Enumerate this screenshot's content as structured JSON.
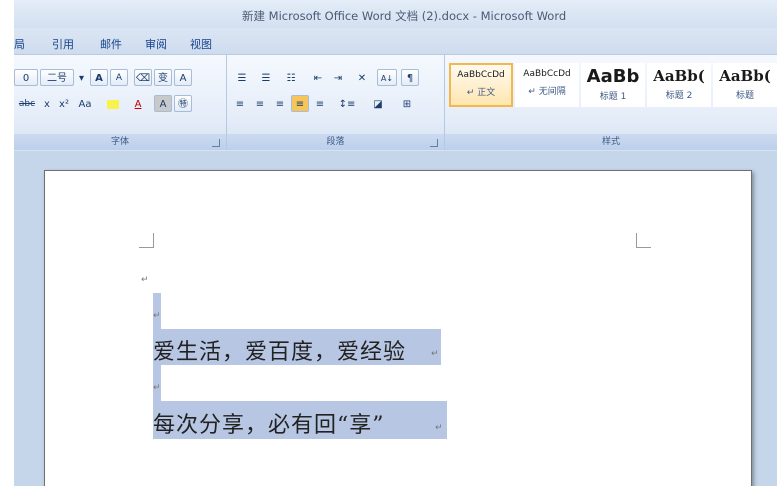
{
  "window": {
    "title": "新建 Microsoft Office Word 文档 (2).docx - Microsoft Word"
  },
  "tabs": [
    {
      "label": "局"
    },
    {
      "label": "引用"
    },
    {
      "label": "邮件"
    },
    {
      "label": "审阅"
    },
    {
      "label": "视图"
    }
  ],
  "ribbon": {
    "font_group": {
      "label": "字体",
      "font_size_fragment": "0",
      "size_box": "二号",
      "grow": "A",
      "shrink": "A",
      "strike": "abc",
      "subscript": "x",
      "superscript": "x²",
      "change_case": "Aa",
      "font_color": "A",
      "char_shading": "A",
      "enclose": "㊕",
      "pinyin": "变",
      "border": "A"
    },
    "paragraph_group": {
      "label": "段落",
      "sort": "A↓"
    },
    "styles_group": {
      "label": "样式",
      "items": [
        {
          "sample": "AaBbCcDd",
          "name": "↵ 正文"
        },
        {
          "sample": "AaBbCcDd",
          "name": "↵ 无间隔"
        },
        {
          "sample": "AaBb",
          "name": "标题 1"
        },
        {
          "sample": "AaBb(",
          "name": "标题 2"
        },
        {
          "sample": "AaBb(",
          "name": "标题"
        }
      ]
    }
  },
  "document": {
    "lines": [
      "爱生活，爱百度，爱经验",
      "每次分享，必有回“享”"
    ],
    "paragraph_mark": "↵"
  },
  "colors": {
    "selection": "#b7c6e3",
    "ribbon_tab_text": "#15428b",
    "selected_style_border": "#f2b84b"
  }
}
